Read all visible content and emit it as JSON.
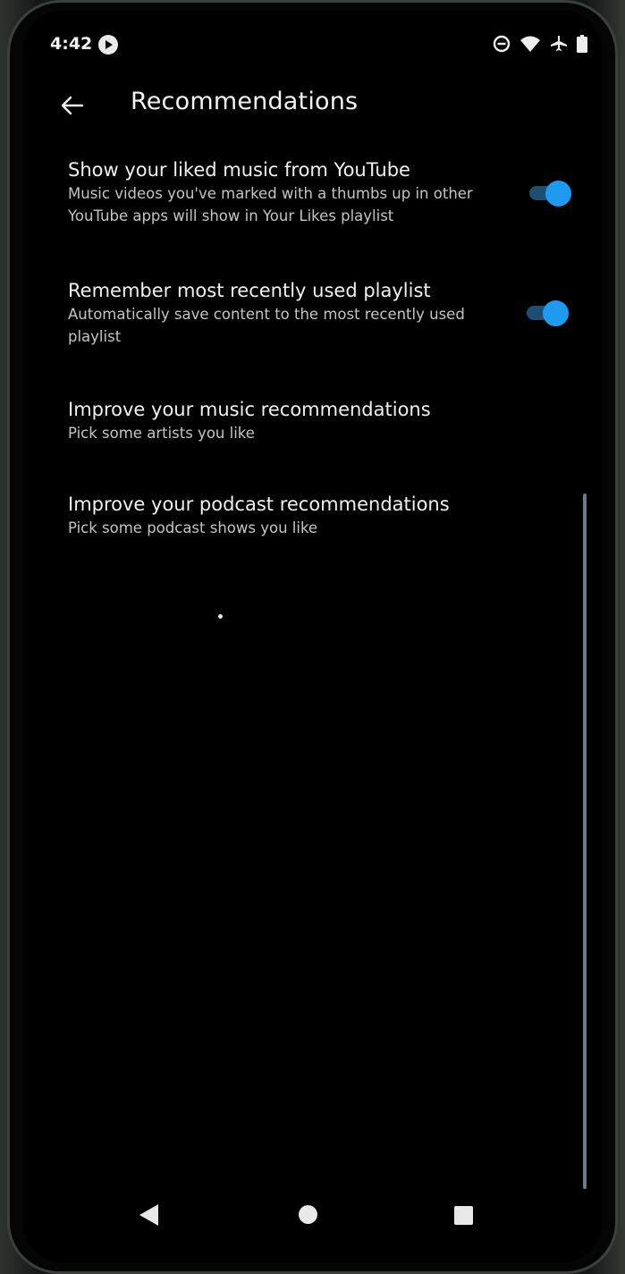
{
  "status_bar": {
    "time": "4:42",
    "icons": [
      "youtube-music-notification-icon",
      "do-not-disturb-icon",
      "wifi-icon",
      "airplane-mode-icon",
      "battery-icon"
    ]
  },
  "app_bar": {
    "back_icon": "arrow-left-icon",
    "title": "Recommendations"
  },
  "settings": [
    {
      "title": "Show your liked music from YouTube",
      "subtitle": "Music videos you've marked with a thumbs up in other YouTube apps will show in Your Likes playlist",
      "toggle": true
    },
    {
      "title": "Remember most recently used playlist",
      "subtitle": "Automatically save content to the most recently used playlist",
      "toggle": true
    },
    {
      "title": "Improve your music recommendations",
      "subtitle": "Pick some artists you like"
    },
    {
      "title": "Improve your podcast recommendations",
      "subtitle": "Pick some podcast shows you like"
    }
  ],
  "nav_bar": {
    "icons": [
      "back-triangle-icon",
      "home-circle-icon",
      "recents-square-icon"
    ]
  },
  "colors": {
    "background": "#000000",
    "accent": "#1e9bf0",
    "toggle_track": "#1d4f73",
    "text_primary": "#f1f1f1",
    "text_secondary": "#c4c4c4"
  }
}
